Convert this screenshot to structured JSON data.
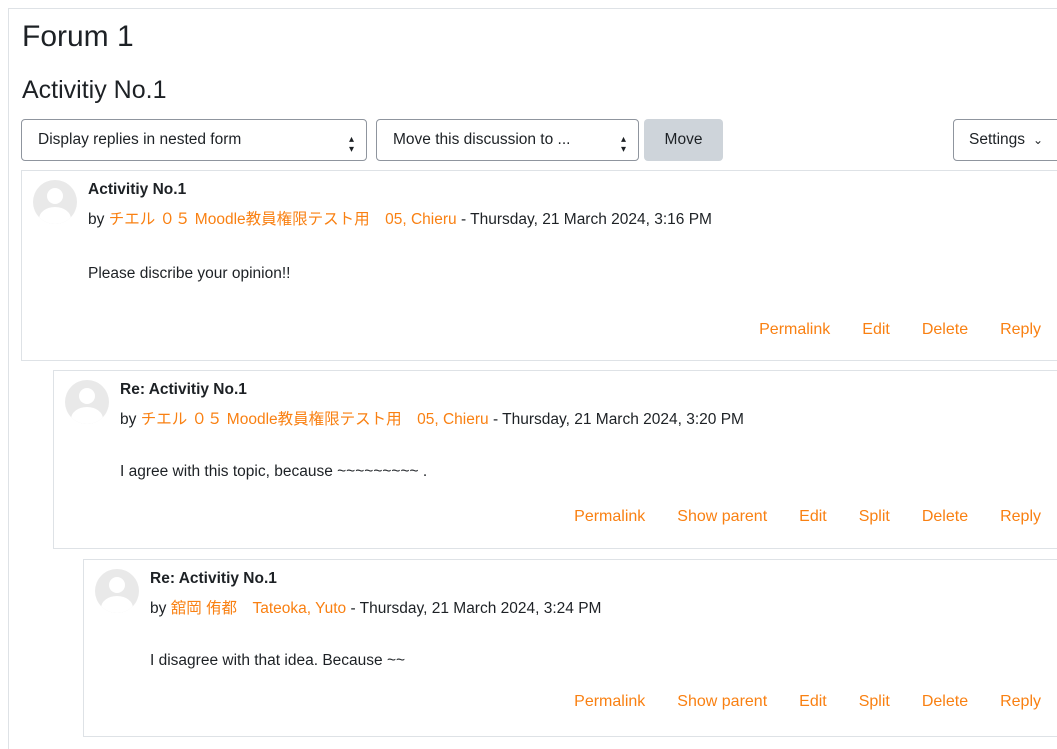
{
  "forum_title": "Forum 1",
  "discussion_title": "Activitiy No.1",
  "controls": {
    "display_mode": "Display replies in nested form",
    "move_to": "Move this discussion to ...",
    "move_button": "Move",
    "settings_button": "Settings"
  },
  "posts": [
    {
      "title": "Activitiy No.1",
      "by": "by",
      "author": "チエル ０５ Moodle教員権限テスト用　05, Chieru",
      "date": "Thursday, 21 March 2024, 3:16 PM",
      "message": "Please discribe your opinion!!",
      "actions": [
        "Permalink",
        "Edit",
        "Delete",
        "Reply"
      ]
    },
    {
      "title": "Re: Activitiy No.1",
      "by": "by",
      "author": "チエル ０５ Moodle教員権限テスト用　05, Chieru",
      "date": "Thursday, 21 March 2024, 3:20 PM",
      "message": "I agree with this topic, because ~~~~~~~~~ .",
      "actions": [
        "Permalink",
        "Show parent",
        "Edit",
        "Split",
        "Delete",
        "Reply"
      ]
    },
    {
      "title": "Re: Activitiy No.1",
      "by": "by",
      "author": "舘岡 侑都　Tateoka, Yuto",
      "date": "Thursday, 21 March 2024, 3:24 PM",
      "message": "I disagree with that idea. Because ~~",
      "actions": [
        "Permalink",
        "Show parent",
        "Edit",
        "Split",
        "Delete",
        "Reply"
      ]
    }
  ],
  "colors": {
    "link": "#f98012",
    "text": "#1d2125",
    "border": "#dee2e6",
    "button_bg": "#ced4da"
  }
}
